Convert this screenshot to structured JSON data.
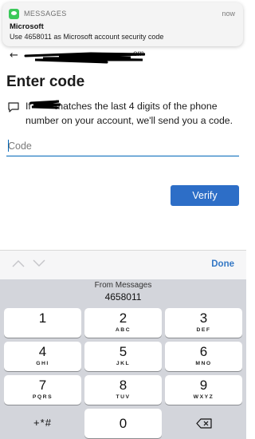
{
  "notification": {
    "app_name": "MESSAGES",
    "time": "now",
    "title": "Microsoft",
    "body": "Use 4658011 as Microsoft account security code"
  },
  "page": {
    "email_suffix": "om",
    "title": "Enter code",
    "info_prefix": "If",
    "info_suffix": "matches the last 4 digits of the phone number on your account, we'll send you a code.",
    "code_input": {
      "value": "",
      "placeholder": "Code"
    },
    "verify_label": "Verify"
  },
  "accessory_bar": {
    "done_label": "Done"
  },
  "keyboard": {
    "suggestion_label": "From Messages",
    "suggestion_code": "4658011",
    "keys": [
      {
        "num": "1",
        "letters": ""
      },
      {
        "num": "2",
        "letters": "ABC"
      },
      {
        "num": "3",
        "letters": "DEF"
      },
      {
        "num": "4",
        "letters": "GHI"
      },
      {
        "num": "5",
        "letters": "JKL"
      },
      {
        "num": "6",
        "letters": "MNO"
      },
      {
        "num": "7",
        "letters": "PQRS"
      },
      {
        "num": "8",
        "letters": "TUV"
      },
      {
        "num": "9",
        "letters": "WXYZ"
      },
      {
        "num": "0",
        "letters": ""
      }
    ],
    "symbols_label": "+*#"
  },
  "colors": {
    "accent_blue": "#2d6ec7",
    "link_blue": "#0067b8",
    "done_blue": "#3478c5",
    "messages_green": "#3bc95a",
    "keyboard_bg": "#d3d5db"
  }
}
